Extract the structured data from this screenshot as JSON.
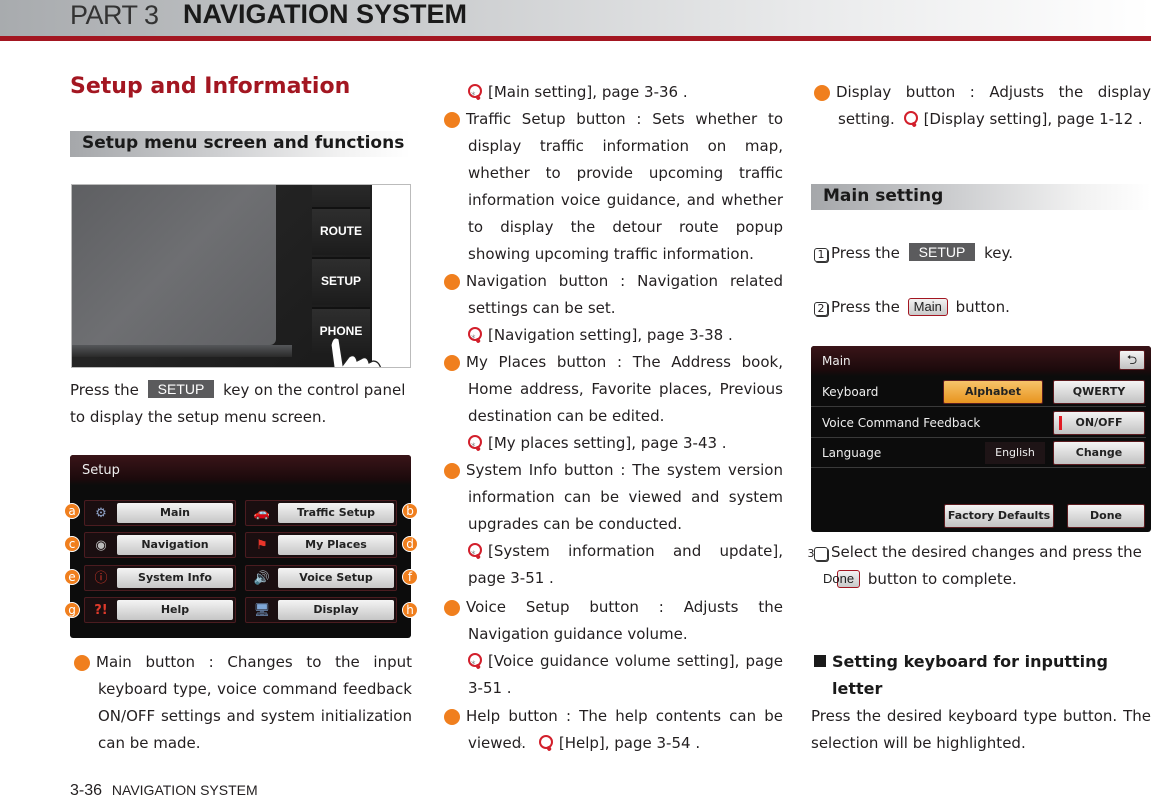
{
  "header": {
    "part": "PART 3",
    "title": "NAVIGATION SYSTEM"
  },
  "page_title": "Setup and Information",
  "section1": {
    "title": "Setup menu screen and functions"
  },
  "device": {
    "keys": [
      "ROUTE",
      "SETUP",
      "PHONE"
    ]
  },
  "intro": {
    "before": "Press the",
    "key": "SETUP",
    "after": "key on the control panel to display the setup menu screen."
  },
  "setup_screen": {
    "title": "Setup",
    "buttons": [
      {
        "id": "a",
        "label": "Main",
        "icon": "gear-icon"
      },
      {
        "id": "b",
        "label": "Traffic Setup",
        "icon": "car-icon"
      },
      {
        "id": "c",
        "label": "Navigation",
        "icon": "navigation-icon"
      },
      {
        "id": "d",
        "label": "My Places",
        "icon": "flag-icon"
      },
      {
        "id": "e",
        "label": "System Info",
        "icon": "info-icon"
      },
      {
        "id": "f",
        "label": "Voice Setup",
        "icon": "speaker-icon"
      },
      {
        "id": "g",
        "label": "Help",
        "icon": "help-icon"
      },
      {
        "id": "h",
        "label": "Display",
        "icon": "monitor-icon"
      }
    ]
  },
  "descriptions": {
    "a": {
      "badge": "a",
      "text": "Main button : Changes to the input keyboard type, voice command feedback ON/OFF settings and system initialization can be made.",
      "ref": "[Main setting], page 3-36 ."
    },
    "b": {
      "badge": "b",
      "text": "Traffic Setup button : Sets whether to display traffic information on map, whether to provide upcoming traffic information voice guidance, and whether to display the detour route popup showing upcoming traffic information."
    },
    "c": {
      "badge": "c",
      "text": "Navigation button : Navigation related settings can be set.",
      "ref": "[Navigation setting], page 3-38 ."
    },
    "d": {
      "badge": "d",
      "text": "My Places button : The Address book, Home address, Favorite places, Previous destination can be edited.",
      "ref": "[My places setting], page 3-43 ."
    },
    "e": {
      "badge": "e",
      "text": "System Info button : The system version information can be viewed and system upgrades can be conducted.",
      "ref": "[System information and update], page 3-51 ."
    },
    "f": {
      "badge": "f",
      "text": "Voice Setup button : Adjusts the Navigation guidance volume.",
      "ref": "[Voice guidance volume setting], page 3-51 ."
    },
    "g": {
      "badge": "g",
      "text": "Help button : The help contents can be viewed.",
      "ref": "[Help], page 3-54 ."
    },
    "h": {
      "badge": "h",
      "text": "Display button : Adjusts the display setting.",
      "ref": "[Display setting], page 1-12 ."
    }
  },
  "section2": {
    "title": "Main setting"
  },
  "steps": [
    {
      "num": "1",
      "before": "Press the",
      "key": "SETUP",
      "after": "key."
    },
    {
      "num": "2",
      "before": "Press the",
      "button": "Main",
      "after": "button."
    },
    {
      "num": "3",
      "before": "Select the desired changes and press the",
      "button": "Done",
      "after": "button to complete."
    }
  ],
  "main_screen": {
    "title": "Main",
    "back_icon": "back-icon",
    "rows": [
      {
        "label": "Keyboard",
        "options": [
          "Alphabet",
          "QWERTY"
        ],
        "selected": "Alphabet"
      },
      {
        "label": "Voice Command Feedback",
        "button": "ON/OFF"
      },
      {
        "label": "Language",
        "value": "English",
        "button": "Change"
      }
    ],
    "factory_defaults": "Factory Defaults",
    "done": "Done"
  },
  "subsection": {
    "title_line1": "Setting keyboard for inputting",
    "title_line2": "letter",
    "body": "Press the desired keyboard type button. The selection will be highlighted."
  },
  "footer": {
    "page": "3-36",
    "label": "NAVIGATION SYSTEM"
  },
  "colors": {
    "accent_red": "#a31621",
    "callout_orange": "#f07f1e",
    "selected_orange": "#e8941f"
  }
}
